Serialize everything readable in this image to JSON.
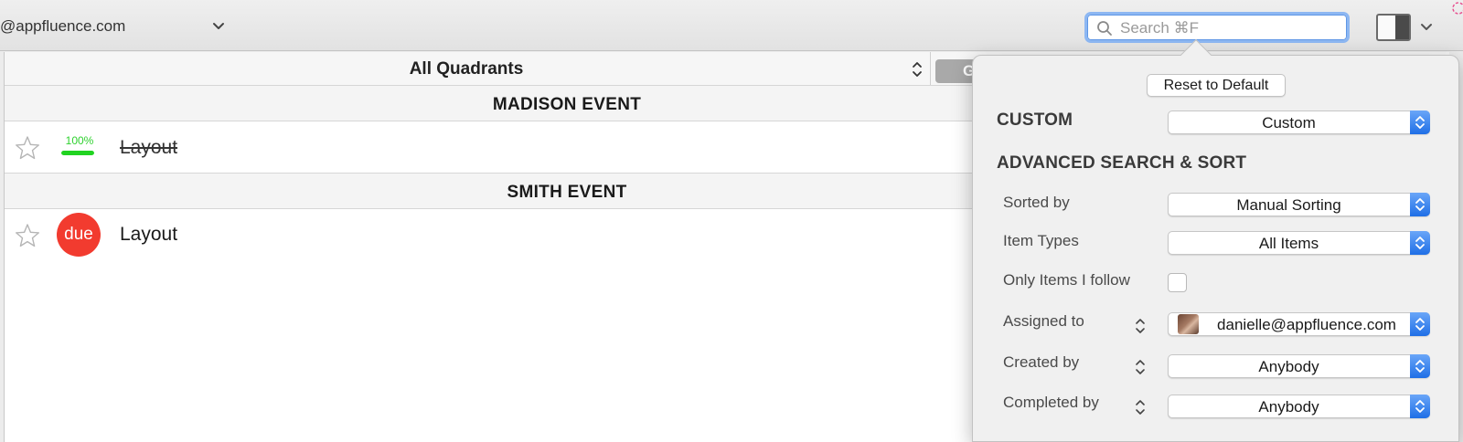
{
  "toolbar": {
    "account": "@appfluence.com",
    "search": {
      "placeholder": "Search ⌘F"
    }
  },
  "filter": {
    "quadrant_selected": "All Quadrants",
    "group_button_label": "G"
  },
  "sections": [
    {
      "title": "MADISON EVENT",
      "tasks": [
        {
          "title": "Layout",
          "progress_label": "100%",
          "progress": 1.0,
          "completed": true,
          "starred": false
        }
      ]
    },
    {
      "title": "SMITH EVENT",
      "tasks": [
        {
          "title": "Layout",
          "badge": "due",
          "completed": false,
          "starred": false
        }
      ]
    }
  ],
  "popover": {
    "reset_button": "Reset to Default",
    "custom_heading": "CUSTOM",
    "custom_value": "Custom",
    "advanced_heading": "ADVANCED SEARCH & SORT",
    "fields": {
      "sorted_by": {
        "label": "Sorted by",
        "value": "Manual Sorting"
      },
      "item_types": {
        "label": "Item Types",
        "value": "All Items"
      },
      "only_follow": {
        "label": "Only Items I follow",
        "checked": false
      },
      "assigned_to": {
        "label": "Assigned to",
        "value": "danielle@appfluence.com"
      },
      "created_by": {
        "label": "Created by",
        "value": "Anybody"
      },
      "completed_by": {
        "label": "Completed by",
        "value": "Anybody"
      }
    }
  },
  "colors": {
    "accent_blue": "#1f6fe6",
    "due_red": "#f23b2f",
    "progress_green": "#21d321"
  }
}
